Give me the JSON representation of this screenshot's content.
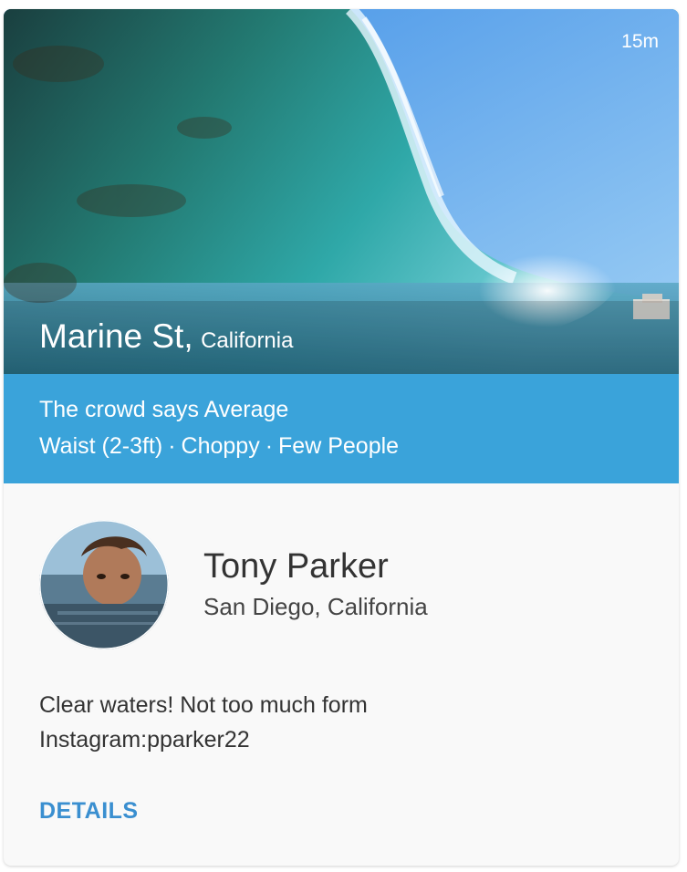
{
  "card": {
    "timestamp": "15m",
    "spot": {
      "name": "Marine St,",
      "region": "California"
    },
    "report": {
      "crowd_text": "The crowd says Average",
      "conditions": [
        "Waist (2-3ft)",
        "Choppy",
        "Few People"
      ],
      "separator": "·"
    },
    "user": {
      "name": "Tony Parker",
      "location": "San Diego, California"
    },
    "comment": {
      "line1": "Clear waters! Not too much form",
      "line2": "Instagram:pparker22"
    },
    "details_label": "DETAILS"
  },
  "colors": {
    "report_bar": "#3aa3da",
    "details_link": "#3a8fd0",
    "card_background": "#f9f9f9"
  }
}
